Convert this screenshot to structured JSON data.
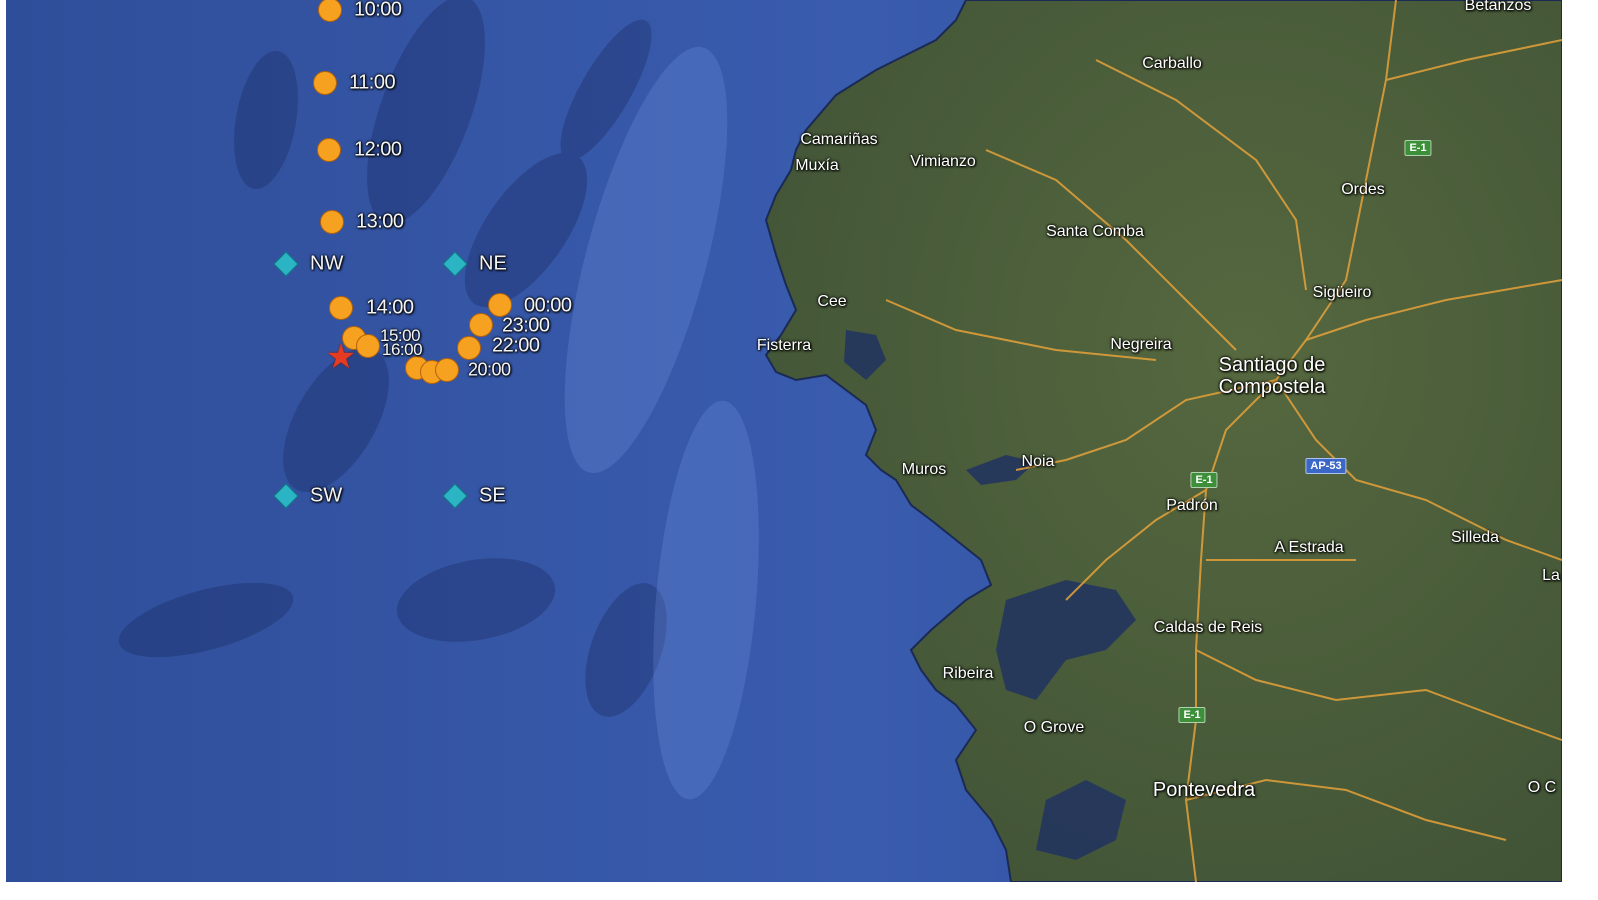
{
  "map": {
    "colors": {
      "ocean": "#2f4f9c",
      "ocean_deep": "#23397a",
      "land": "#4a5d3c",
      "road": "#e5a23a",
      "buoy_track": "#f7a120",
      "corner_marker": "#2ab4c4",
      "origin_marker": "#e53b22"
    },
    "towns": {
      "betanzos": "Betanzos",
      "carballo": "Carballo",
      "camarinas": "Camariñas",
      "muxia": "Muxía",
      "vimianzo": "Vimianzo",
      "ordes": "Ordes",
      "santa_comba": "Santa Comba",
      "cee": "Cee",
      "fisterra": "Fisterra",
      "sigueiro": "Sigüeiro",
      "negreira": "Negreira",
      "santiago": "Santiago de Compostela",
      "muros": "Muros",
      "noia": "Noia",
      "padron": "Padrón",
      "a_estrada": "A Estrada",
      "silleda": "Silleda",
      "caldas": "Caldas de Reis",
      "ribeira": "Ribeira",
      "o_grove": "O Grove",
      "pontevedra": "Pontevedra",
      "la": "La",
      "o_c": "O C"
    },
    "road_shields": {
      "e1_north": "E-1",
      "e1_mid": "E-1",
      "e1_south": "E-1",
      "ap53": "AP-53"
    },
    "corner_labels": {
      "nw": "NW",
      "ne": "NE",
      "sw": "SW",
      "se": "SE"
    },
    "time_labels": {
      "t10": "10:00",
      "t11": "11:00",
      "t12": "12:00",
      "t13": "13:00",
      "t14": "14:00",
      "t00": "00:00",
      "t23": "23:00",
      "t22": "22:00",
      "t15": "15:00",
      "t16": "16:00",
      "t20": "20:00"
    }
  }
}
